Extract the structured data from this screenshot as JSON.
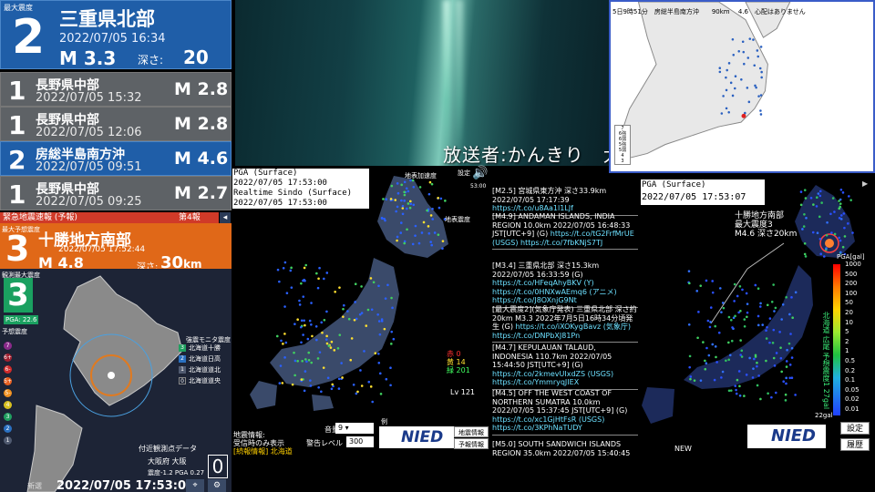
{
  "broadcast": "放送者:かんきり　大阪",
  "latest": {
    "label": "最大震度",
    "intensity": "2",
    "place": "三重県北部",
    "datetime": "2022/07/05 16:34",
    "magnitude": "M 3.3",
    "depth_label": "深さ:",
    "depth_value": "20",
    "depth_unit": "km"
  },
  "history": [
    {
      "intensity": "1",
      "place": "長野県中部",
      "datetime": "2022/07/05 15:32",
      "magnitude": "M 2.8",
      "style": "gray"
    },
    {
      "intensity": "1",
      "place": "長野県中部",
      "datetime": "2022/07/05 12:06",
      "magnitude": "M 2.8",
      "style": "gray"
    },
    {
      "intensity": "2",
      "place": "房総半島南方沖",
      "datetime": "2022/07/05 09:51",
      "magnitude": "M 4.6",
      "style": "blue"
    },
    {
      "intensity": "1",
      "place": "長野県中部",
      "datetime": "2022/07/05 09:25",
      "magnitude": "M 2.7",
      "style": "gray"
    }
  ],
  "eew": {
    "header": "緊急地震速報 (予報)",
    "report_no": "第4報",
    "collapse": "◂",
    "label": "最大予想震度",
    "intensity": "3",
    "place": "十勝地方南部",
    "datetime": "2022/07/05 17:52:44",
    "magnitude": "M 4.8",
    "depth_label": "深さ:",
    "depth_value": "30",
    "depth_unit": "km",
    "observed_label": "観測最大震度",
    "observed_intensity": "3",
    "pga": "PGA: 22.6",
    "forecast_label": "予想震度",
    "scale": [
      "7",
      "6+",
      "6-",
      "5+",
      "5-",
      "4",
      "3",
      "2",
      "1"
    ],
    "legend_title": "強震モニタ震度",
    "legend": [
      {
        "value": "3",
        "label": "北海道十勝"
      },
      {
        "value": "2",
        "label": "北海道日高"
      },
      {
        "value": "1",
        "label": "北海道道北"
      },
      {
        "value": "0",
        "label": "北海道道央"
      }
    ],
    "near_label": "付近観測点データ",
    "station": "大阪府 大阪",
    "station_values": "震度-1.2  PGA 0.27",
    "station_intensity": "0",
    "refresh": "新選",
    "time": "2022/07/05 17:53:07",
    "buttons": [
      "⌖",
      "⚙"
    ]
  },
  "realtime": {
    "caption_top": "PGA (Surface)",
    "caption_top_time": "2022/07/05 17:53:00",
    "caption_bottom": "Realtime Sindo (Surface)",
    "caption_bottom_time": "2022/07/05 17:53:00",
    "depth_label": "地表加速度",
    "settings": "設定",
    "time": "53:00",
    "speaker": "🔊",
    "depth2": "地表震度",
    "counts": [
      {
        "label": "赤",
        "value": "0",
        "color": "#ff3030"
      },
      {
        "label": "黄",
        "value": "14",
        "color": "#ffe030"
      },
      {
        "label": "緑",
        "value": "201",
        "color": "#40ff60"
      }
    ],
    "level": "Lv 121",
    "info_lines": [
      "地震情報:",
      "受信時のみ表示",
      "[続報情報] 北海道"
    ],
    "volume_label": "音量",
    "volume": "9",
    "warn_label": "警告レベル",
    "warn": "300",
    "example": "例",
    "logo": "NIED",
    "btn1": "地震情報",
    "btn2": "予報情報"
  },
  "feed": [
    {
      "text": "[M2.5] 宮城県東方沖 深さ33.9km 2022/07/05 17:17:39",
      "link": "https://t.co/u8Aa1l1LJf"
    },
    {
      "text": "[M4.9] ANDAMAN ISLANDS, INDIA REGION 10.0km 2022/07/05 16:48:33 JST[UTC+9] (G)",
      "link": "https://t.co/tG2FrfMrUE (USGS) https://t.co/7fbKNjS7TJ"
    },
    {
      "text": "[M3.4] 三重県北部 深さ15.3km 2022/07/05 16:33:59 (G)",
      "link": "https://t.co/HFeqAhyBKV (Y) https://t.co/0HNXwAEmq6 (アニメ) https://t.co/J8OXnjG9Nt"
    },
    {
      "text": "[最大震度2](気象庁発表) 三重県北部 深さ約20km M3.3 2022年7月5日16時34分頃発生 (G)",
      "link": "https://t.co/iXOKygBavz (気象庁) https://t.co/DNPbXJ81Pn"
    },
    {
      "text": "[M4.7] KEPULAUAN TALAUD, INDONESIA 110.7km 2022/07/05 15:44:50 JST[UTC+9] (G)",
      "link": "https://t.co/2kmevUIxdZS (USGS) https://t.co/YmmryqJIEX"
    },
    {
      "text": "[M4.5] OFF THE WEST COAST OF NORTHERN SUMATRA 10.0km 2022/07/05 15:37:45 JST[UTC+9] (G)",
      "link": "https://t.co/xc1GjHtFsR (USGS) https://t.co/3KPhNaTUDY"
    },
    {
      "text": "[M5.0] SOUTH SANDWICH ISLANDS REGION 35.0km 2022/07/05 15:40:45",
      "link": ""
    }
  ],
  "pga": {
    "caption_top": "PGA (Surface)",
    "caption": "2022/07/05 17:53:07",
    "play": "▶",
    "annot_place": "十勝地方南部",
    "annot_max": "最大震度3",
    "annot_mag": "M4.6 深さ20km",
    "unit": "PGA[gal]",
    "ticks": [
      "1000",
      "500",
      "200",
      "100",
      "50",
      "20",
      "10",
      "5",
      "2",
      "1",
      "0.5",
      "0.2",
      "0.1",
      "0.05",
      "0.02",
      "0.01"
    ],
    "hokkaido": "北海道 広尾 予想震度1 27gal",
    "gal22": "22gal",
    "new_label": "NEW",
    "logo": "NIED",
    "btn_settings": "設定",
    "btn_history": "履歴"
  },
  "mini_map": {
    "header": "5日9時51分　房総半島南方沖　　90km　 4.6　心配はありません",
    "legend": [
      "7",
      "6強",
      "6弱",
      "5強",
      "5弱",
      "4",
      "3",
      "2",
      "1"
    ]
  },
  "colors": {
    "eq_blue": "#1f5ea8",
    "eq_gray": "#5e6266",
    "eew_orange": "#e06818",
    "observed_green": "#1aa060",
    "eew_red": "#d03a28"
  }
}
